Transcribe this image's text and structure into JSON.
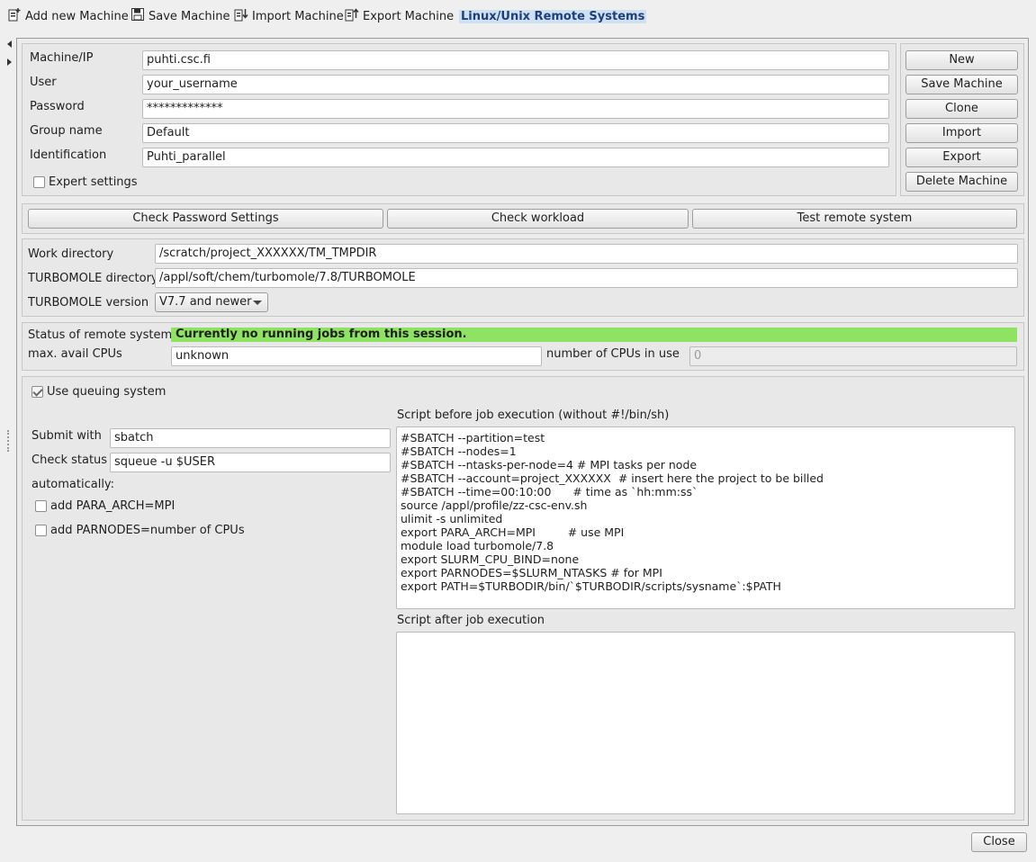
{
  "toolbar": {
    "add_machine": "Add new Machine",
    "save_machine": "Save Machine",
    "import_machine": "Import Machine",
    "export_machine": "Export Machine",
    "active_tab": "Linux/Unix Remote Systems"
  },
  "machine": {
    "machine_ip_label": "Machine/IP",
    "machine_ip_value": "puhti.csc.fi",
    "user_label": "User",
    "user_value": "your_username",
    "password_label": "Password",
    "password_value": "*************",
    "group_label": "Group name",
    "group_value": "Default",
    "identification_label": "Identification",
    "identification_value": "Puhti_parallel",
    "expert_settings_label": "Expert settings",
    "expert_settings_checked": false
  },
  "side_buttons": {
    "new": "New",
    "save": "Save Machine",
    "clone": "Clone",
    "import": "Import",
    "export": "Export",
    "delete": "Delete Machine"
  },
  "checks": {
    "password_settings": "Check Password Settings",
    "workload": "Check workload",
    "test_remote": "Test remote system"
  },
  "dirs": {
    "work_dir_label": "Work directory",
    "work_dir_value": "/scratch/project_XXXXXX/TM_TMPDIR",
    "turbomole_dir_label": "TURBOMOLE directory",
    "turbomole_dir_value": "/appl/soft/chem/turbomole/7.8/TURBOMOLE",
    "turbomole_version_label": "TURBOMOLE version",
    "turbomole_version_value": "V7.7 and newer"
  },
  "status": {
    "status_label": "Status of remote system",
    "status_value": "Currently no running jobs from this session.",
    "status_color": "#8ee363",
    "max_cpus_label": "max. avail CPUs",
    "max_cpus_value": "unknown",
    "cpus_in_use_label": "number of CPUs in use",
    "cpus_in_use_value": "0"
  },
  "queue": {
    "use_queuing_label": "Use queuing system",
    "use_queuing_checked": true,
    "submit_label": "Submit with",
    "submit_value": "sbatch",
    "check_status_label": "Check status",
    "check_status_value": "squeue -u $USER",
    "automatically_label": "automatically:",
    "para_arch_label": "add PARA_ARCH=MPI",
    "parnodes_label": "add PARNODES=number of CPUs",
    "script_before_label": "Script before job execution (without #!/bin/sh)",
    "script_before_lines": [
      "#SBATCH --partition=test",
      "#SBATCH --nodes=1",
      "#SBATCH --ntasks-per-node=4 # MPI tasks per node",
      "#SBATCH --account=project_XXXXXX  # insert here the project to be billed",
      "#SBATCH --time=00:10:00      # time as `hh:mm:ss`",
      "source /appl/profile/zz-csc-env.sh",
      "ulimit -s unlimited",
      "export PARA_ARCH=MPI         # use MPI",
      "module load turbomole/7.8",
      "export SLURM_CPU_BIND=none",
      "export PARNODES=$SLURM_NTASKS # for MPI",
      "export PATH=$TURBODIR/bin/`$TURBODIR/scripts/sysname`:$PATH"
    ],
    "script_after_label": "Script after job execution",
    "script_after_value": ""
  },
  "footer": {
    "close": "Close"
  },
  "icons": {
    "add": "add-machine-icon",
    "save": "floppy-disk-icon",
    "import": "import-icon",
    "export": "export-icon"
  }
}
